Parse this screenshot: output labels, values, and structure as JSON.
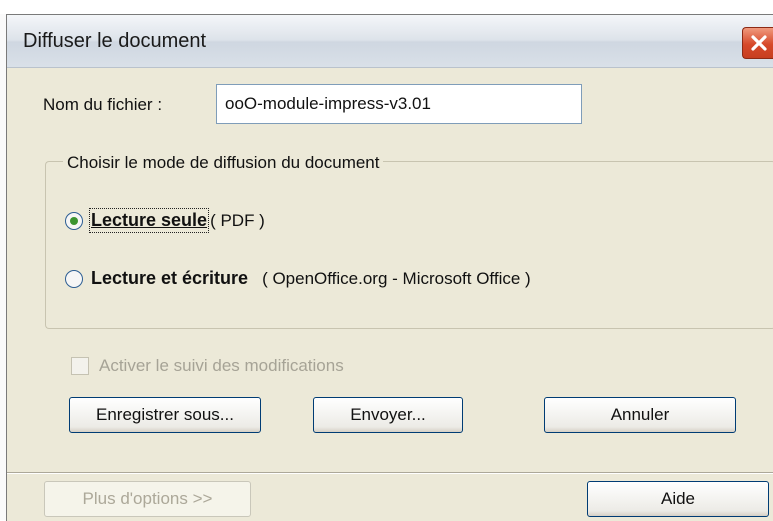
{
  "dialog": {
    "title": "Diffuser le document"
  },
  "filename": {
    "label": "Nom du fichier :",
    "value": "ooO-module-impress-v3.01"
  },
  "mode_group": {
    "legend": "Choisir le mode de diffusion du document",
    "options": [
      {
        "label": "Lecture seule",
        "detail": "( PDF )",
        "selected": true
      },
      {
        "label": "Lecture et écriture",
        "detail": "( OpenOffice.org - Microsoft Office )",
        "selected": false
      }
    ]
  },
  "track_changes": {
    "label": "Activer le suivi des modifications",
    "enabled": false,
    "checked": false
  },
  "buttons": {
    "save_as": "Enregistrer sous...",
    "send": "Envoyer...",
    "cancel": "Annuler",
    "more_options": "Plus d'options >>",
    "help": "Aide"
  },
  "colors": {
    "dialog_bg": "#ece9d8",
    "close_button": "#d6492a",
    "radio_dot": "#3b9430"
  }
}
